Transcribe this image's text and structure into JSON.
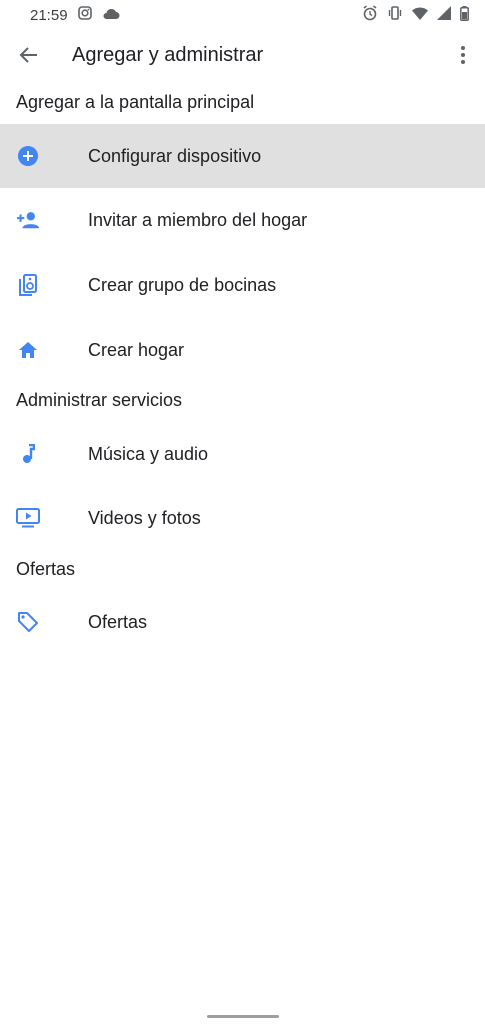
{
  "status_bar": {
    "time": "21:59"
  },
  "app_bar": {
    "title": "Agregar y administrar"
  },
  "sections": [
    {
      "header": "Agregar a la pantalla principal",
      "items": [
        {
          "label": "Configurar dispositivo",
          "icon": "add-circle-icon"
        },
        {
          "label": "Invitar a miembro del hogar",
          "icon": "person-add-icon"
        },
        {
          "label": "Crear grupo de bocinas",
          "icon": "speaker-group-icon"
        },
        {
          "label": "Crear hogar",
          "icon": "home-icon"
        }
      ]
    },
    {
      "header": "Administrar servicios",
      "items": [
        {
          "label": "Música y audio",
          "icon": "music-note-icon"
        },
        {
          "label": "Videos y fotos",
          "icon": "video-icon"
        }
      ]
    },
    {
      "header": "Ofertas",
      "items": [
        {
          "label": "Ofertas",
          "icon": "tag-icon"
        }
      ]
    }
  ],
  "colors": {
    "accent": "#4285f4",
    "selected_bg": "#e0e0e0",
    "text": "#202124"
  }
}
